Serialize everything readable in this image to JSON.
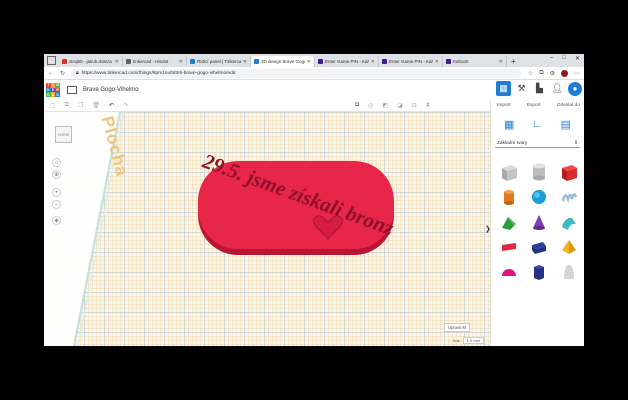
{
  "browser": {
    "tabs": [
      {
        "label": "struj60 - jakub.doleza",
        "color": "#d93025",
        "active": false
      },
      {
        "label": "tinkercad - Hledat",
        "color": "#5f6368",
        "active": false
      },
      {
        "label": "Řídicí panel | Tinkerca",
        "color": "#1f7ed4",
        "active": false
      },
      {
        "label": "3D design Brave Gogo-",
        "color": "#1f7ed4",
        "active": true
      },
      {
        "label": "Enter Game PIN - Kah",
        "color": "#46178f",
        "active": false
      },
      {
        "label": "Enter Game PIN - Kah",
        "color": "#46178f",
        "active": false
      },
      {
        "label": "Kahoot!",
        "color": "#46178f",
        "active": false
      }
    ],
    "new_tab": "+",
    "url": "https://www.tinkercad.com/things/8pm1nu0dtn6-brave-gogo-vihelmo/edit"
  },
  "app": {
    "logo_letters": [
      "TIN",
      "KER",
      "CAD"
    ],
    "design_title": "Brave Gogo-Vihelmo",
    "actions": {
      "import": "Import",
      "export": "Export",
      "send": "Odeslat do"
    }
  },
  "panel": {
    "select_label": "Základní tvary",
    "collapse_glyph": "❯"
  },
  "workplane": {
    "label": "Plocha",
    "view_cube_label": "HORNÍ",
    "model_text": "29.5. jsme získali bronz",
    "edit_grid": "Upravit M",
    "snap_label": "Kok",
    "snap_value": "1,0 mm"
  },
  "colors": {
    "accent": "#1f7ed4",
    "model_red": "#e8264a",
    "model_text": "#8e1028"
  }
}
